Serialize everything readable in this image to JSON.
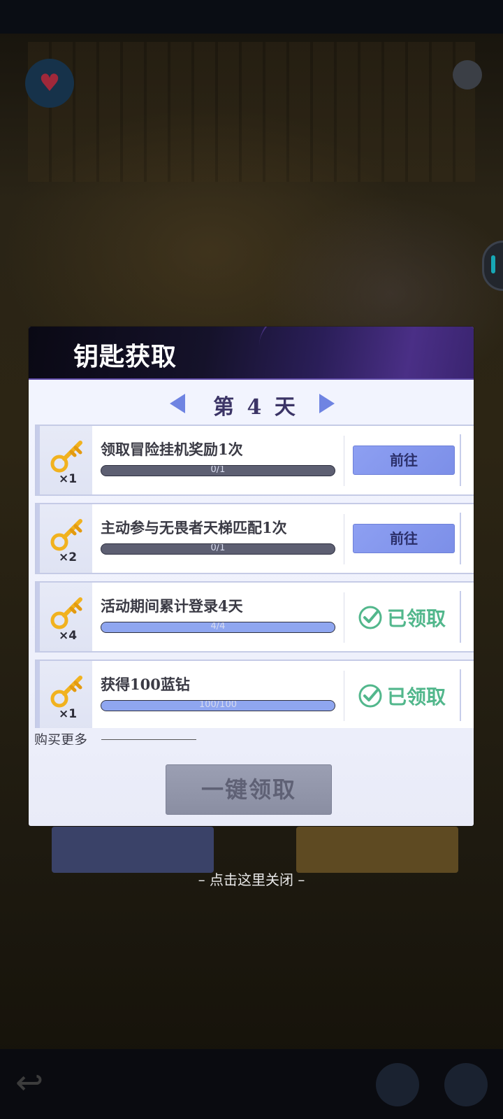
{
  "modal": {
    "title": "钥匙获取",
    "day_label": "第 4 天",
    "tasks": [
      {
        "key_count": "×1",
        "title": "领取冒险挂机奖励1次",
        "progress_text": "0/1",
        "progress": 0.0,
        "status": "前往"
      },
      {
        "key_count": "×2",
        "title": "主动参与无畏者天梯匹配1次",
        "progress_text": "0/1",
        "progress": 0.0,
        "status": "前往"
      },
      {
        "key_count": "×4",
        "title": "活动期间累计登录4天",
        "progress_text": "4/4",
        "progress": 1.0,
        "status": "已领取"
      },
      {
        "key_count": "×1",
        "title": "获得100蓝钻",
        "progress_text": "100/100",
        "progress": 1.0,
        "status": "已领取"
      }
    ],
    "buy_more_label": "购买更多",
    "claim_all_label": "一键领取"
  },
  "close_hint": "– 点击这里关闭 –",
  "colors": {
    "header_dark": "#0a0914",
    "header_accent": "#4a2f86",
    "go_button": "#8d9ff2",
    "claimed_green": "#52b78c",
    "progress_fill": "#8fa6f0",
    "progress_track": "#5d5f72"
  },
  "icons": [
    "key-icon",
    "arrow-left-icon",
    "arrow-right-icon",
    "check-circle-icon",
    "heart-icon",
    "gear-icon",
    "back-arrow-icon"
  ]
}
